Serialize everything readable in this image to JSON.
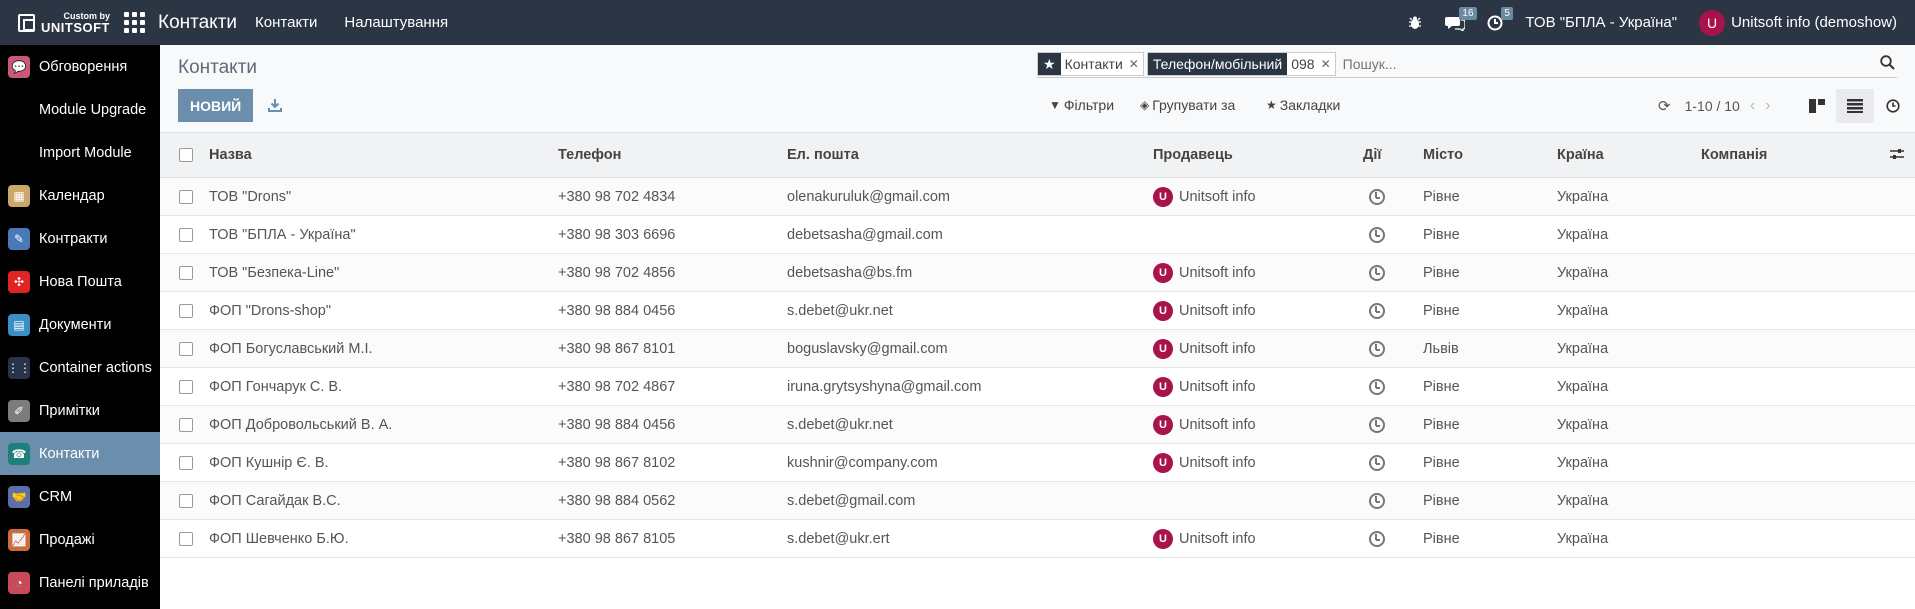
{
  "brand": {
    "small": "Custom by",
    "name": "UNITSOFT"
  },
  "navbar": {
    "app_title": "Контакти",
    "menu": [
      "Контакти",
      "Налаштування"
    ],
    "messages_count": "16",
    "activities_count": "5",
    "company": "ТОВ \"БПЛА - Україна\"",
    "user_initial": "U",
    "user_name": "Unitsoft info (demoshow)"
  },
  "sidebar": {
    "items": [
      {
        "label": "Обговорення",
        "icon": "chat-icon",
        "color": "#c85a78",
        "glyph": "💬"
      },
      {
        "label": "Module Upgrade",
        "icon": "",
        "color": "",
        "glyph": ""
      },
      {
        "label": "Import Module",
        "icon": "",
        "color": "",
        "glyph": ""
      },
      {
        "label": "Календар",
        "icon": "calendar-icon",
        "color": "#c9a86a",
        "glyph": "▦"
      },
      {
        "label": "Контракти",
        "icon": "contract-icon",
        "color": "#4a79b8",
        "glyph": "✎"
      },
      {
        "label": "Нова Пошта",
        "icon": "nova-poshta-icon",
        "color": "#e02424",
        "glyph": "✣"
      },
      {
        "label": "Документи",
        "icon": "documents-icon",
        "color": "#3a8fc4",
        "glyph": "▤"
      },
      {
        "label": "Container actions",
        "icon": "container-icon",
        "color": "#27344a",
        "glyph": "⋮⋮"
      },
      {
        "label": "Примітки",
        "icon": "notes-icon",
        "color": "#7c7c7c",
        "glyph": "✐"
      },
      {
        "label": "Контакти",
        "icon": "contacts-icon",
        "color": "#1f7f7a",
        "glyph": "☎"
      },
      {
        "label": "CRM",
        "icon": "crm-icon",
        "color": "#5d6fa8",
        "glyph": "🤝"
      },
      {
        "label": "Продажі",
        "icon": "sales-icon",
        "color": "#c96e3a",
        "glyph": "📈"
      },
      {
        "label": "Панелі приладів",
        "icon": "dashboard-icon",
        "color": "#c84a5a",
        "glyph": "◔"
      }
    ],
    "active_index": 9
  },
  "control": {
    "breadcrumb": "Контакти",
    "new_button": "НОВИЙ",
    "search": {
      "facet1_value": "Контакти",
      "facet2_label": "Телефон/мобільний",
      "facet2_value": "098",
      "placeholder": "Пошук..."
    },
    "filters": "Фільтри",
    "group_by": "Групувати за",
    "favorites": "Закладки",
    "pager": "1-10 / 10"
  },
  "table": {
    "headers": {
      "name": "Назва",
      "phone": "Телефон",
      "email": "Ел. пошта",
      "seller": "Продавець",
      "activities": "Дії",
      "city": "Місто",
      "country": "Країна",
      "company": "Компанія"
    },
    "rows": [
      {
        "name": "ТОВ \"Drons\"",
        "phone": "+380 98 702 4834",
        "email": "olenakuruluk@gmail.com",
        "seller": "Unitsoft info",
        "city": "Рівне",
        "country": "Україна",
        "company": ""
      },
      {
        "name": "ТОВ \"БПЛА - Україна\"",
        "phone": "+380 98 303 6696",
        "email": "debetsasha@gmail.com",
        "seller": "",
        "city": "Рівне",
        "country": "Україна",
        "company": ""
      },
      {
        "name": "ТОВ \"Безпека-Line\"",
        "phone": "+380 98 702 4856",
        "email": "debetsasha@bs.fm",
        "seller": "Unitsoft info",
        "city": "Рівне",
        "country": "Україна",
        "company": ""
      },
      {
        "name": "ФОП \"Drons-shop\"",
        "phone": "+380 98 884 0456",
        "email": "s.debet@ukr.net",
        "seller": "Unitsoft info",
        "city": "Рівне",
        "country": "Україна",
        "company": ""
      },
      {
        "name": "ФОП Богуславський М.І.",
        "phone": "+380 98 867 8101",
        "email": "boguslavsky@gmail.com",
        "seller": "Unitsoft info",
        "city": "Львів",
        "country": "Україна",
        "company": ""
      },
      {
        "name": "ФОП Гончарук С. В.",
        "phone": "+380 98 702 4867",
        "email": "iruna.grytsyshyna@gmail.com",
        "seller": "Unitsoft info",
        "city": "Рівне",
        "country": "Україна",
        "company": ""
      },
      {
        "name": "ФОП Добровольський В. А.",
        "phone": "+380 98 884 0456",
        "email": "s.debet@ukr.net",
        "seller": "Unitsoft info",
        "city": "Рівне",
        "country": "Україна",
        "company": ""
      },
      {
        "name": "ФОП Кушнір Є. В.",
        "phone": "+380 98 867 8102",
        "email": "kushnir@company.com",
        "seller": "Unitsoft info",
        "city": "Рівне",
        "country": "Україна",
        "company": ""
      },
      {
        "name": "ФОП Сагайдак В.С.",
        "phone": "+380 98 884 0562",
        "email": "s.debet@gmail.com",
        "seller": "",
        "city": "Рівне",
        "country": "Україна",
        "company": ""
      },
      {
        "name": "ФОП Шевченко Б.Ю.",
        "phone": "+380 98 867 8105",
        "email": "s.debet@ukr.ert",
        "seller": "Unitsoft info",
        "city": "Рівне",
        "country": "Україна",
        "company": ""
      }
    ],
    "seller_initial": "U"
  }
}
